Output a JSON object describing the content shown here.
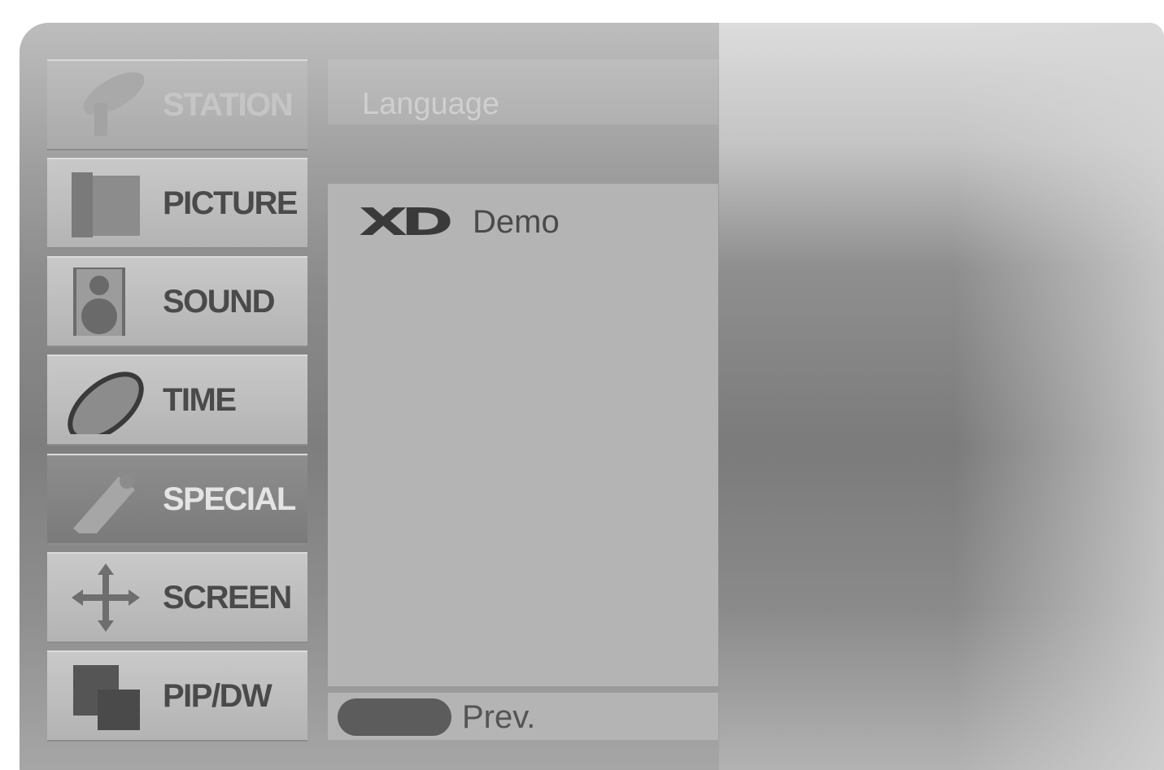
{
  "menu": {
    "items": [
      {
        "label": "STATION",
        "icon": "satellite-icon",
        "state": "dim"
      },
      {
        "label": "PICTURE",
        "icon": "picture-icon",
        "state": "normal"
      },
      {
        "label": "SOUND",
        "icon": "speaker-icon",
        "state": "normal"
      },
      {
        "label": "TIME",
        "icon": "clock-icon",
        "state": "normal"
      },
      {
        "label": "SPECIAL",
        "icon": "tag-icon",
        "state": "active"
      },
      {
        "label": "SCREEN",
        "icon": "arrows-icon",
        "state": "normal"
      },
      {
        "label": "PIP/DW",
        "icon": "pip-icon",
        "state": "normal"
      }
    ]
  },
  "panel": {
    "header": "Language",
    "options": [
      {
        "logo": "XD",
        "label": "Demo"
      }
    ]
  },
  "footer": {
    "prev_label": "Prev."
  }
}
